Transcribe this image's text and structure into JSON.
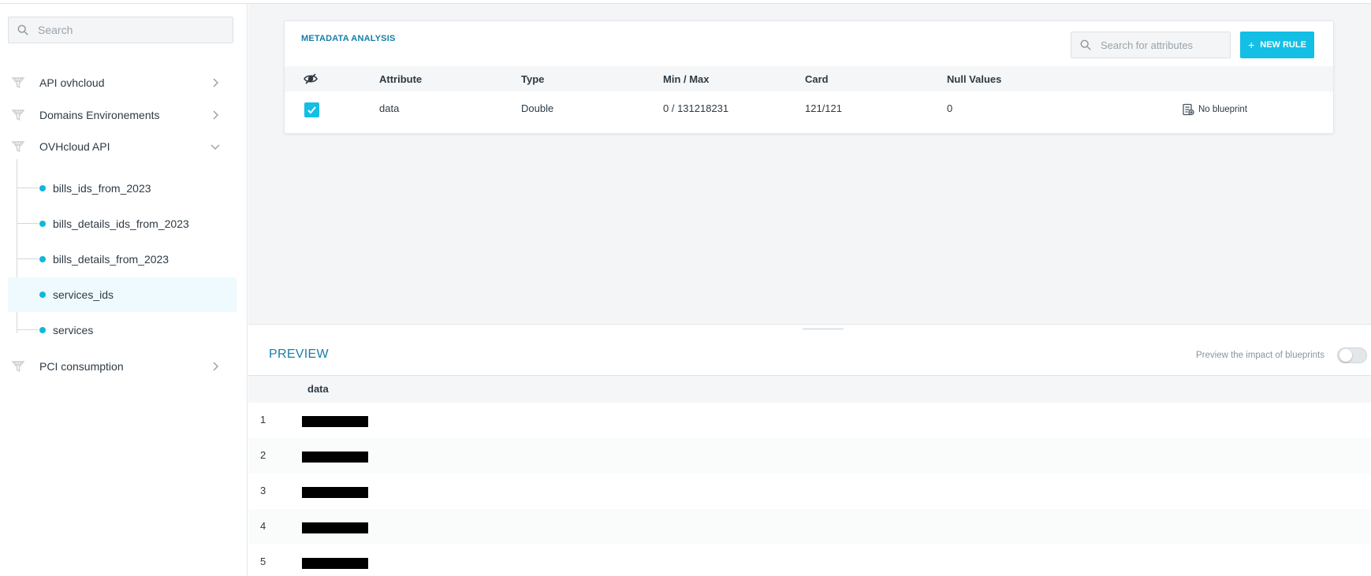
{
  "sidebar": {
    "search_placeholder": "Search",
    "groups": [
      {
        "label": "API ovhcloud",
        "state": "collapsed",
        "icon": "funnel-icon"
      },
      {
        "label": "Domains Environements",
        "state": "collapsed",
        "icon": "funnel-icon"
      },
      {
        "label": "OVHcloud API",
        "state": "expanded",
        "icon": "funnel-icon"
      },
      {
        "label": "PCI consumption",
        "state": "collapsed",
        "icon": "funnel-icon"
      }
    ],
    "datasets": [
      {
        "label": "bills_ids_from_2023"
      },
      {
        "label": "bills_details_ids_from_2023"
      },
      {
        "label": "bills_details_from_2023"
      },
      {
        "label": "services_ids",
        "selected": true
      },
      {
        "label": "services"
      }
    ]
  },
  "metadata": {
    "title": "METADATA ANALYSIS",
    "search_placeholder": "Search for attributes",
    "new_rule_label": "NEW RULE",
    "columns": [
      "Attribute",
      "Type",
      "Min / Max",
      "Card",
      "Null Values"
    ],
    "rows": [
      {
        "attribute": "data",
        "type": "Double",
        "min_max": "0 / 131218231",
        "card": "121/121",
        "null_values": "0",
        "checked": true,
        "blueprint": "No blueprint"
      }
    ]
  },
  "preview": {
    "title": "PREVIEW",
    "impact_label": "Preview the impact of blueprints",
    "impact_enabled": false,
    "column": "data",
    "rows": [
      "1",
      "2",
      "3",
      "4",
      "5"
    ]
  },
  "colors": {
    "accent": "#14bfe5",
    "title_blue": "#177ea8",
    "selected_bg": "#eefafd"
  }
}
